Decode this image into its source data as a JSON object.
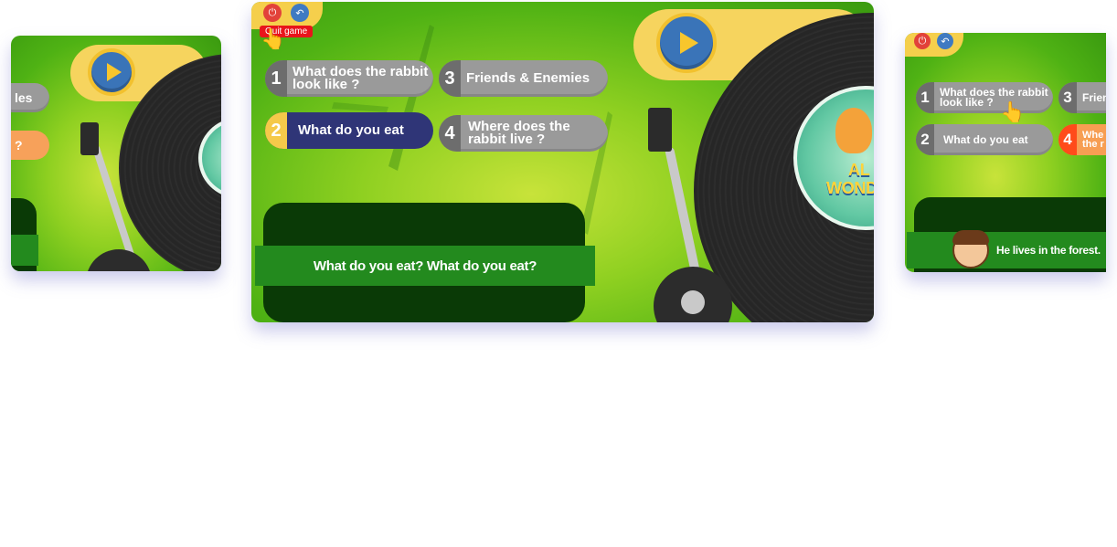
{
  "left_card": {
    "options": [
      {
        "label": "les"
      },
      {
        "label": "?"
      }
    ]
  },
  "main_card": {
    "controls": {
      "power_icon": "power-icon",
      "back_icon": "back-icon",
      "tooltip": "Quit game"
    },
    "options": [
      {
        "number": "1",
        "label": "What does the rabbit look like ?"
      },
      {
        "number": "2",
        "label": "What do you eat"
      },
      {
        "number": "3",
        "label": "Friends & Enemies"
      },
      {
        "number": "4",
        "label": "Where does the rabbit live ?"
      }
    ],
    "caption": "What do you eat? What do you eat?",
    "disc_label": {
      "line1": "AL",
      "line2": "WOND"
    }
  },
  "right_card": {
    "options": [
      {
        "number": "1",
        "label": "What does the rabbit look like ?"
      },
      {
        "number": "2",
        "label": "What do you eat"
      },
      {
        "number": "3",
        "label": "Frien"
      },
      {
        "number": "4",
        "label": "Whe the r"
      }
    ],
    "caption": "He lives in the forest."
  },
  "colors": {
    "selected": "#2f3577",
    "selected_number": "#f5c94a",
    "option": "#9a9a9a",
    "highlight_number": "#ff4b1a",
    "panel": "#0a3a06",
    "banner": "#238a1e"
  }
}
